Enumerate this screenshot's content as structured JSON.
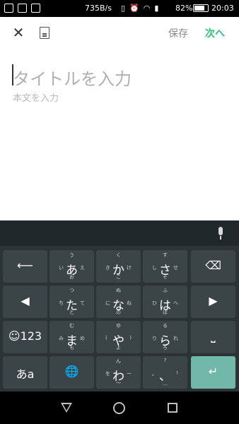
{
  "status_bar": {
    "network_speed": "735B/s",
    "battery_percent": "82%",
    "time": "20:03",
    "battery_level": 0.82,
    "icons": [
      "gallery-icon",
      "image-icon",
      "bag-icon",
      "vibrate-icon",
      "alarm-icon",
      "wifi-icon",
      "signal-icon",
      "battery-icon"
    ]
  },
  "app_bar": {
    "close_icon": "close-icon",
    "doc_icon": "document-icon",
    "save_label": "保存",
    "next_label": "次へ",
    "accent_color": "#2ec17a"
  },
  "editor": {
    "title_placeholder": "タイトルを入力",
    "body_placeholder": "本文を入力"
  },
  "keyboard": {
    "mic_icon": "mic-icon",
    "keys": [
      {
        "name": "undo-key",
        "icon": "undo-arrow-icon",
        "symbol": "⟵"
      },
      {
        "name": "key-a",
        "top": "う",
        "left": "い",
        "center": "あ",
        "right": "え",
        "bottom": "お"
      },
      {
        "name": "key-ka",
        "top": "く",
        "left": "き",
        "center": "か",
        "right": "け",
        "bottom": "こ"
      },
      {
        "name": "key-sa",
        "top": "す",
        "left": "し",
        "center": "さ",
        "right": "せ",
        "bottom": "そ"
      },
      {
        "name": "delete-key",
        "icon": "backspace-icon",
        "symbol": "⌫"
      },
      {
        "name": "left-arrow-key",
        "icon": "left-arrow-icon",
        "symbol": "◀"
      },
      {
        "name": "key-ta",
        "top": "つ",
        "left": "ち",
        "center": "た",
        "right": "て",
        "bottom": "と"
      },
      {
        "name": "key-na",
        "top": "ぬ",
        "left": "に",
        "center": "な",
        "right": "ね",
        "bottom": "の"
      },
      {
        "name": "key-ha",
        "top": "ふ",
        "left": "ひ",
        "center": "は",
        "right": "へ",
        "bottom": "ほ"
      },
      {
        "name": "right-arrow-key",
        "icon": "right-arrow-icon",
        "symbol": "▶"
      },
      {
        "name": "emoji-123-key",
        "icon": "emoji-icon",
        "symbol": "☺123"
      },
      {
        "name": "key-ma",
        "top": "む",
        "left": "み",
        "center": "ま",
        "right": "め",
        "bottom": "も"
      },
      {
        "name": "key-ya",
        "top": "ゆ",
        "left": "(",
        "center": "や",
        "right": ")",
        "bottom": "よ"
      },
      {
        "name": "key-ra",
        "top": "る",
        "left": "り",
        "center": "ら",
        "right": "れ",
        "bottom": "ろ"
      },
      {
        "name": "space-key",
        "icon": "space-icon",
        "symbol": "⎵"
      },
      {
        "name": "kana-toggle-key",
        "symbol": "あa"
      },
      {
        "name": "globe-key",
        "icon": "globe-icon",
        "symbol": "🌐"
      },
      {
        "name": "key-wa",
        "top": "ん",
        "left": "を",
        "center": "わ",
        "right": "ー",
        "bottom": "〜"
      },
      {
        "name": "key-punct",
        "top": "?",
        "left": "。",
        "center": "、",
        "right": "!",
        "bottom": "…"
      },
      {
        "name": "enter-key",
        "icon": "enter-icon",
        "symbol": "↵"
      }
    ]
  },
  "nav_bar": {
    "back_icon": "back-triangle-icon",
    "home_icon": "home-circle-icon",
    "recent_icon": "recent-square-icon"
  }
}
